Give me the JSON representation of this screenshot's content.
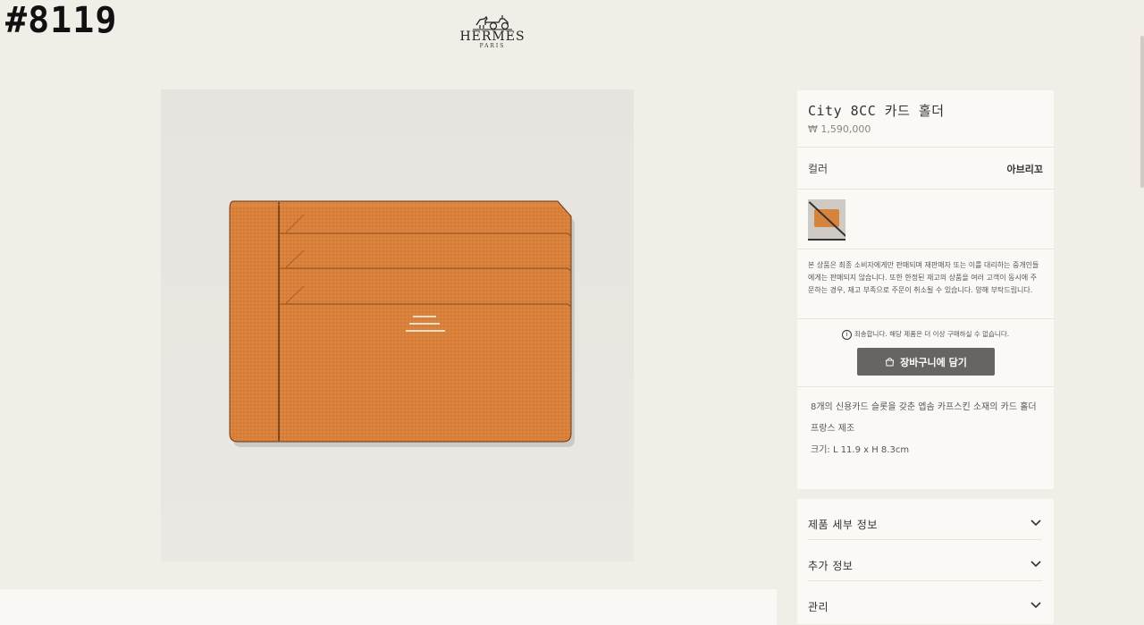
{
  "overlay_tag": "#8119",
  "brand": {
    "name": "HERMES",
    "city": "PARIS"
  },
  "product": {
    "title": "City 8CC 카드 홀더",
    "price": "₩ 1,590,000",
    "color_label": "컬러",
    "color_value": "아브리꼬",
    "swatch_color": "#d6843c",
    "leather_color": "#d9813a",
    "notice": "본 상품은 최종 소비자에게만 판매되며 재판매자 또는 이를 대리하는 중개인들에게는 판매되지 않습니다. 또한 한정된 재고의 상품을 여러 고객이 동시에 주문하는 경우, 재고 부족으로 주문이 취소될 수 있습니다. 양해 부탁드립니다.",
    "out_of_stock_msg": "죄송합니다. 해당 제품은 더 이상 구매하실 수 없습니다.",
    "cart_button": "장바구니에 담기",
    "description": "8개의 신용카드 슬롯을 갖춘 엡솜 카프스킨 소재의 카드 홀더",
    "origin": "프랑스 제조",
    "size": "크기: L 11.9 x H 8.3cm"
  },
  "accordion": [
    {
      "label": "제품 세부 정보"
    },
    {
      "label": "추가 정보"
    },
    {
      "label": "관리"
    }
  ],
  "icons": {
    "logo": "horse-carriage-icon",
    "info": "info-circle-icon",
    "cart": "shopping-bag-icon",
    "chevron": "chevron-down-icon"
  }
}
